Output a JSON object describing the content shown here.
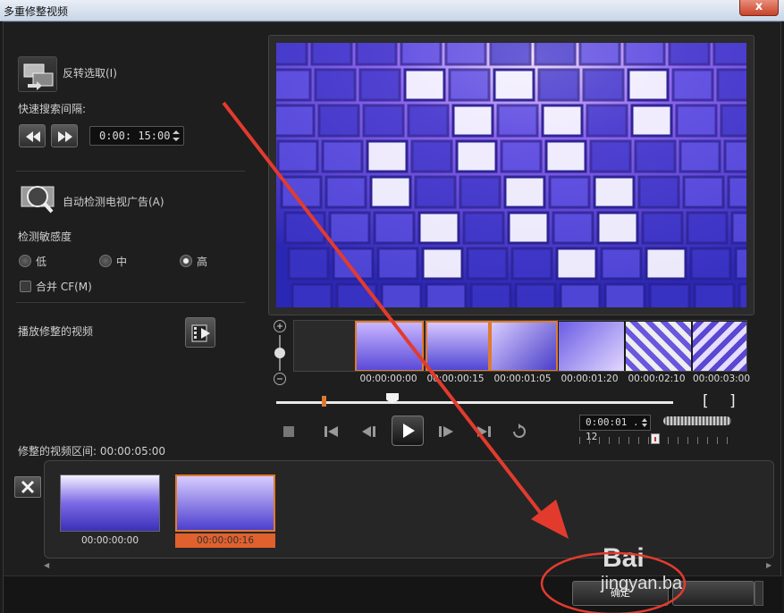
{
  "window": {
    "title": "多重修整视频",
    "close_label": "x"
  },
  "left_panel": {
    "invert_selection_label": "反转选取(I)",
    "quick_search_label": "快速搜索间隔:",
    "search_interval_value": "0:00: 15:00",
    "auto_detect_label": "自动检测电视广告(A)",
    "sensitivity_label": "检测敏感度",
    "sensitivity_options": [
      {
        "label": "低",
        "selected": false
      },
      {
        "label": "中",
        "selected": false
      },
      {
        "label": "高",
        "selected": true
      }
    ],
    "merge_cf_label": "合并 CF(M)",
    "play_trimmed_label": "播放修整的视频"
  },
  "timeline": {
    "timecodes": [
      "00:00:00:00",
      "00:00:00:15",
      "00:00:01:05",
      "00:00:01:20",
      "00:00:02:10",
      "00:00:03:00"
    ],
    "mark_in_label": "[",
    "mark_out_label": "]",
    "current_time": "0:00:01 . 12"
  },
  "trimmed": {
    "duration_label": "修整的视频区间: 00:00:05:00",
    "clips": [
      {
        "label": "00:00:00:00",
        "selected": false
      },
      {
        "label": "00:00:00:16",
        "selected": true
      }
    ]
  },
  "footer": {
    "ok_label": "确定"
  },
  "watermark": {
    "brand": "Bai",
    "site": "jingyan.ba"
  },
  "colors": {
    "accent": "#e07a2e",
    "annotation_red": "#e23b2e"
  }
}
